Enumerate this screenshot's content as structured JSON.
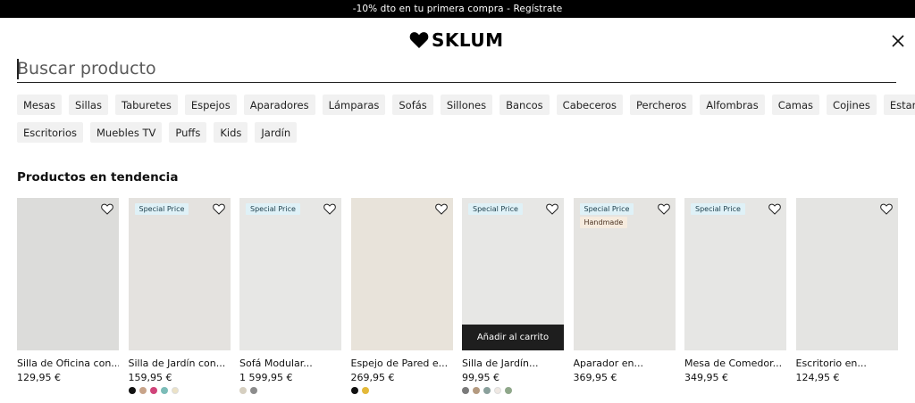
{
  "promo": {
    "text": "-10% dto en tu primera compra - Regístrate"
  },
  "header": {
    "brand": "SKLUM"
  },
  "search": {
    "placeholder": "Buscar producto"
  },
  "categories": {
    "row1": [
      "Mesas",
      "Sillas",
      "Taburetes",
      "Espejos",
      "Aparadores",
      "Lámparas",
      "Sofás",
      "Sillones",
      "Bancos",
      "Cabeceros",
      "Percheros",
      "Alfombras",
      "Camas",
      "Cojines",
      "Estanterías"
    ],
    "row2": [
      "Escritorios",
      "Muebles TV",
      "Puffs",
      "Kids",
      "Jardín"
    ]
  },
  "trending": {
    "title": "Productos en tendencia",
    "products": [
      {
        "name": "Silla de Oficina con...",
        "price": "129,95 €",
        "badges": [],
        "swatches": []
      },
      {
        "name": "Silla de Jardín con...",
        "price": "159,95 €",
        "badges": [
          "Special Price"
        ],
        "swatches": [
          "#111111",
          "#c8a48a",
          "#d0447a",
          "#7cbcb8",
          "#ece2c6"
        ]
      },
      {
        "name": "Sofá Modular...",
        "price": "1 599,95 €",
        "badges": [
          "Special Price"
        ],
        "swatches": [
          "#d6cfc0",
          "#8c8c8c"
        ]
      },
      {
        "name": "Espejo de Pared e...",
        "price": "269,95 €",
        "badges": [],
        "swatches": [
          "#111111",
          "#e4b93a"
        ]
      },
      {
        "name": "Silla de Jardín...",
        "price": "99,95 €",
        "badges": [
          "Special Price"
        ],
        "swatches": [
          "#7a7a7a",
          "#b49a80",
          "#8aa09c",
          "#efe8e3",
          "#8fa78a"
        ],
        "cta": "Añadir al carrito"
      },
      {
        "name": "Aparador en...",
        "price": "369,95 €",
        "badges": [
          "Special Price",
          "Handmade"
        ],
        "swatches": []
      },
      {
        "name": "Mesa de Comedor...",
        "price": "349,95 €",
        "badges": [
          "Special Price"
        ],
        "swatches": []
      },
      {
        "name": "Escritorio en...",
        "price": "124,95 €",
        "badges": [],
        "swatches": []
      }
    ]
  },
  "icons": {
    "logo": "heart-icon",
    "close": "close-icon",
    "favorite": "heart-outline-icon"
  },
  "colors": {
    "promo_bg": "#000000",
    "chip_bg": "#f1f1f1",
    "badge_special": "#dff1f7",
    "badge_handmade": "#f6ebde",
    "cta_bg": "#1e1e1e"
  }
}
